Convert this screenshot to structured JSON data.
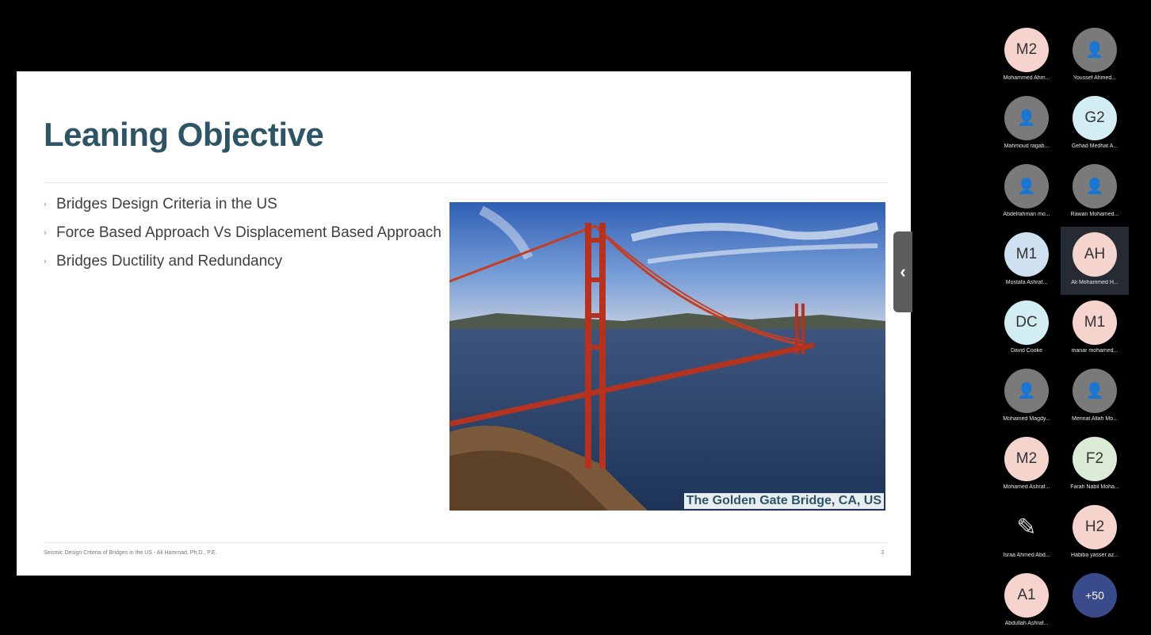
{
  "slide": {
    "title": "Leaning Objective",
    "bullets": [
      "Bridges Design Criteria in the US",
      "Force Based Approach Vs Displacement Based Approach",
      "Bridges Ductility and Redundancy"
    ],
    "image_caption": "The Golden Gate Bridge, CA, US",
    "footer": "Seismic Design Criteria of Bridges in the US - Ali Hammad, Ph.D., P.E.",
    "page_number": "3"
  },
  "panel_toggle_icon": "chevron-left-icon",
  "participants": [
    {
      "initials": "M2",
      "name": "Mohammed Ahm...",
      "color": "pink"
    },
    {
      "initials": "",
      "name": "Youssef Ahmed...",
      "color": "photo"
    },
    {
      "initials": "",
      "name": "Mahmoud ragab...",
      "color": "photo"
    },
    {
      "initials": "G2",
      "name": "Gehad Medhat A...",
      "color": "cyan"
    },
    {
      "initials": "",
      "name": "Abdelrahman mo...",
      "color": "photo"
    },
    {
      "initials": "",
      "name": "Rawan Mohamed...",
      "color": "photo"
    },
    {
      "initials": "M1",
      "name": "Mostafa Ashraf...",
      "color": "blue"
    },
    {
      "initials": "AH",
      "name": "Ali Mohammed H...",
      "color": "pink",
      "active": true
    },
    {
      "initials": "DC",
      "name": "David Cooke",
      "color": "cyan"
    },
    {
      "initials": "M1",
      "name": "manar mohamed...",
      "color": "pink"
    },
    {
      "initials": "",
      "name": "Mohamed Magdy...",
      "color": "photo"
    },
    {
      "initials": "",
      "name": "Mennat Allah Mo...",
      "color": "photo"
    },
    {
      "initials": "M2",
      "name": "Mohamed Ashraf...",
      "color": "pink"
    },
    {
      "initials": "F2",
      "name": "Farah Nabil Moha...",
      "color": "green"
    },
    {
      "initials": "",
      "name": "Israa Ahmed Abd...",
      "color": "icon"
    },
    {
      "initials": "H2",
      "name": "Habiba yasser az...",
      "color": "pink"
    },
    {
      "initials": "A1",
      "name": "Abdullah Ashraf...",
      "color": "pink"
    },
    {
      "initials": "+50",
      "name": "",
      "color": "more"
    }
  ]
}
